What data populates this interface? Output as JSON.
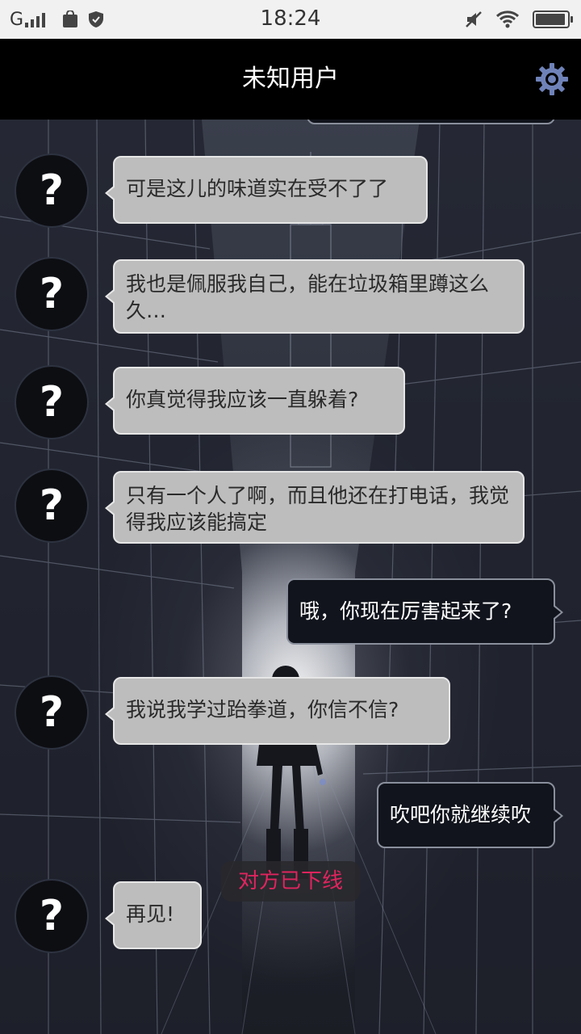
{
  "status_bar": {
    "carrier": "G",
    "time": "18:24",
    "battery_level": 0.95,
    "icons": [
      "signal-icon",
      "shopping-bag-icon",
      "shield-icon",
      "mute-icon",
      "wifi-icon",
      "battery-icon"
    ]
  },
  "header": {
    "title": "未知用户",
    "settings_icon": "gear-icon",
    "accent": "#6f82b8"
  },
  "chat": {
    "avatar_glyph": "?",
    "messages": [
      {
        "from": "other",
        "text": "可是这儿的味道实在受不了了"
      },
      {
        "from": "other",
        "text": "我也是佩服我自己，能在垃圾箱里蹲这么久…"
      },
      {
        "from": "other",
        "text": "你真觉得我应该一直躲着?"
      },
      {
        "from": "other",
        "text": "只有一个人了啊，而且他还在打电话，我觉得我应该能搞定"
      },
      {
        "from": "me",
        "text": "哦，你现在厉害起来了?"
      },
      {
        "from": "other",
        "text": "我说我学过跆拳道，你信不信?"
      },
      {
        "from": "me",
        "text": "吹吧你就继续吹"
      },
      {
        "from": "other",
        "text": "再见!"
      }
    ],
    "status_notice": "对方已下线",
    "status_color": "#e0245e"
  }
}
